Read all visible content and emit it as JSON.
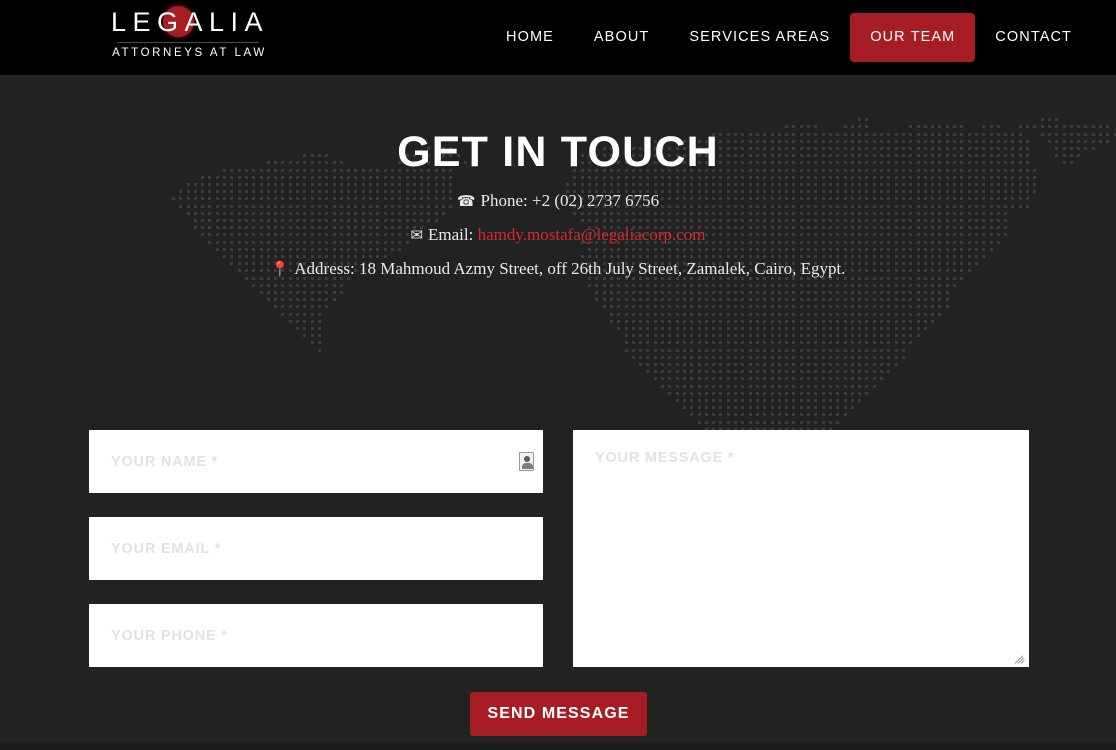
{
  "brand": {
    "name_part1": "LE",
    "name_g": "G",
    "name_part2": "ALIA",
    "full_name": "LEGALIA",
    "tagline": "ATTORNEYS AT LAW",
    "accent_color": "#a61e23"
  },
  "nav": {
    "items": [
      {
        "label": "HOME",
        "active": false
      },
      {
        "label": "ABOUT",
        "active": false
      },
      {
        "label": "SERVICES AREAS",
        "active": false
      },
      {
        "label": "OUR TEAM",
        "active": true
      },
      {
        "label": "CONTACT",
        "active": false
      }
    ],
    "active_label": "OUR TEAM",
    "active_background": "#a61e23"
  },
  "hero": {
    "title": "GET IN TOUCH",
    "phone_icon": "phone-icon",
    "phone_label": "Phone:",
    "phone_value": "+2 (02) 2737 6756",
    "email_icon": "envelope-icon",
    "email_label": "Email:",
    "email_value": "hamdy.mostafa@legaliacorp.com",
    "email_color": "#d42a2a",
    "address_icon": "map-pin-icon",
    "address_label": "Address:",
    "address_value": "18 Mahmoud Azmy Street, off 26th July Street, Zamalek, Cairo, Egypt.",
    "background_color": "#222222",
    "map_dot_color": "#3c3c3c"
  },
  "form": {
    "name": {
      "placeholder": "YOUR NAME *",
      "value": ""
    },
    "email": {
      "placeholder": "YOUR EMAIL *",
      "value": ""
    },
    "phone": {
      "placeholder": "YOUR PHONE *",
      "value": ""
    },
    "message": {
      "placeholder": "YOUR MESSAGE *",
      "value": ""
    },
    "autofill_icon": "contact-card-icon",
    "resize_handle": "resize-grip-icon",
    "submit_label": "SEND MESSAGE",
    "submit_color": "#a61e23"
  }
}
